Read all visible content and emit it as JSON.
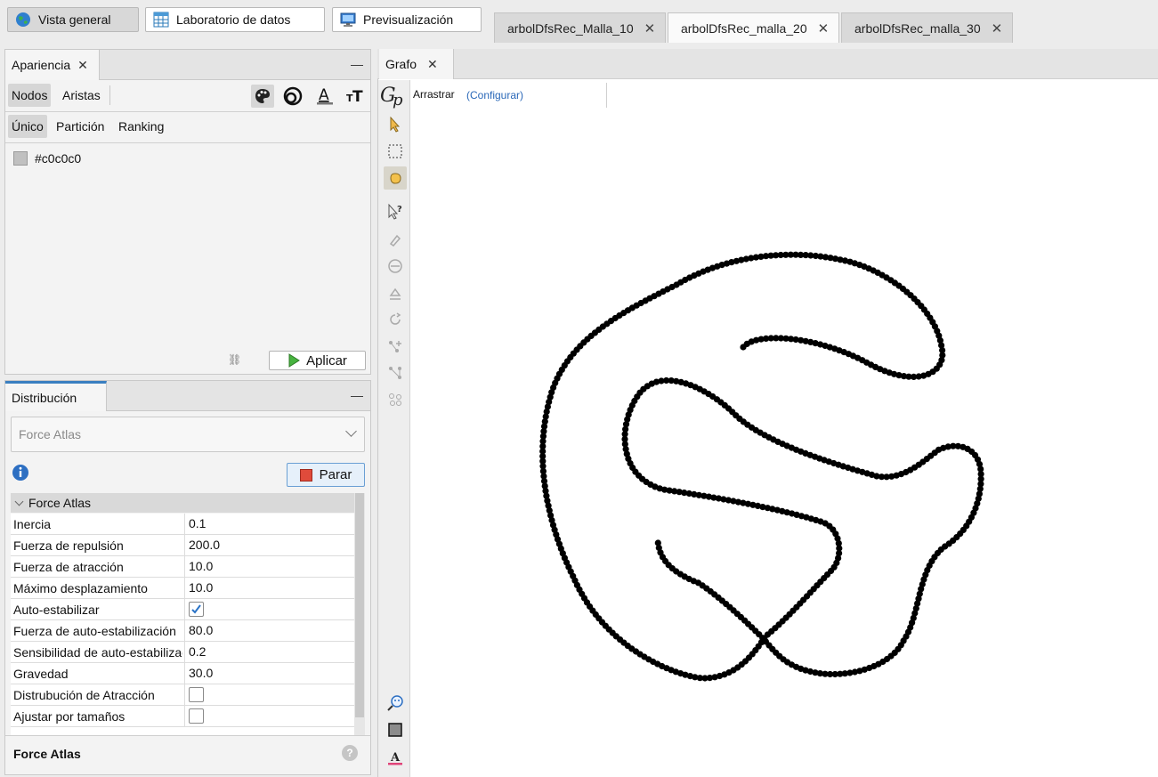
{
  "top_modes": [
    {
      "label": "Vista general",
      "icon": "globe-icon",
      "active": true
    },
    {
      "label": "Laboratorio de datos",
      "icon": "table-icon",
      "active": false
    },
    {
      "label": "Previsualización",
      "icon": "monitor-icon",
      "active": false
    }
  ],
  "workspace_tabs": [
    {
      "label": "arbolDfsRec_Malla_10",
      "active": false
    },
    {
      "label": "arbolDfsRec_malla_20",
      "active": true
    },
    {
      "label": "arbolDfsRec_malla_30",
      "active": false
    }
  ],
  "appearance": {
    "title": "Apariencia",
    "target_tabs": [
      "Nodos",
      "Aristas"
    ],
    "mode_tabs": [
      "Único",
      "Partición",
      "Ranking"
    ],
    "tools": [
      "palette-icon",
      "size-icon",
      "label-color-icon",
      "label-size-icon"
    ],
    "color_value": "#c0c0c0",
    "apply_label": "Aplicar"
  },
  "layout": {
    "title": "Distribución",
    "algorithm": "Force Atlas",
    "stop_label": "Parar",
    "section": "Force Atlas",
    "properties": [
      {
        "name": "Inercia",
        "value": "0.1"
      },
      {
        "name": "Fuerza de repulsión",
        "value": "200.0"
      },
      {
        "name": "Fuerza de atracción",
        "value": "10.0"
      },
      {
        "name": "Máximo desplazamiento",
        "value": "10.0"
      },
      {
        "name": "Auto-estabilizar",
        "value": true
      },
      {
        "name": "Fuerza de auto-estabilización",
        "value": "80.0"
      },
      {
        "name": "Sensibilidad de auto-estabilización",
        "value": "0.2"
      },
      {
        "name": "Gravedad",
        "value": "30.0"
      },
      {
        "name": "Distrubución de Atracción",
        "value": false
      },
      {
        "name": "Ajustar por tamaños",
        "value": false
      }
    ],
    "footer_title": "Force Atlas"
  },
  "graph": {
    "tab_title": "Grafo",
    "mode_label": "Arrastrar",
    "configure_link": "(Configurar)",
    "node_color": "#000000",
    "tools": [
      "pointer-icon",
      "rectangle-select-icon",
      "drag-hand-icon",
      "edit-query-icon",
      "painter-icon",
      "resize-icon",
      "brush-icon",
      "rotate-icon",
      "add-node-icon",
      "add-edge-icon",
      "shortest-path-icon",
      "zoom-icon",
      "background-color-icon",
      "font-color-icon"
    ]
  }
}
